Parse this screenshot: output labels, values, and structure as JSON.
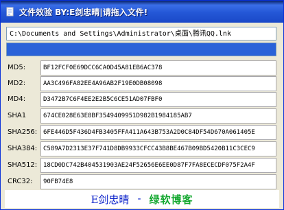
{
  "titlebar": {
    "title": "文件效验 BY:E剑忠晴|请拖入文件!",
    "icon": "app-icon"
  },
  "file_path": "C:\\Documents and Settings\\Administrator\\桌面\\腾讯QQ.lnk",
  "progress": {
    "value": 1.0,
    "color": "#2a62d8"
  },
  "hashes": [
    {
      "label": "MD5:",
      "value": "BF12FCF0E69DCC6CA0D45A81EB6AC378"
    },
    {
      "label": "MD2:",
      "value": "AA3C496FA82EE4A96AB2F19E0DB08098"
    },
    {
      "label": "MD4:",
      "value": "D3472B7C6F4EE2E2B5C6CE51AD07FBF0"
    },
    {
      "label": "SHA1",
      "value": "674CE028E63E8BF3549409951D982B1984185AB7"
    },
    {
      "label": "SHA256:",
      "value": "6FE446D5F436D4FB3405FFA411A643B753A2D0C84DF54D670A061405E"
    },
    {
      "label": "SHA384:",
      "value": "C589A7D2313E37F741D8DB9933CFCC43B8BE467B09BD5420B11C3CEC9"
    },
    {
      "label": "SHA512:",
      "value": "18CD0DC742B404531903AE24F52656E6EE0D87F7FA8ECECDF075F2A4F"
    },
    {
      "label": "CRC32:",
      "value": "90FB74E8"
    }
  ],
  "footer": {
    "author": "E剑忠晴",
    "dash": "-",
    "blog": "绿软博客"
  },
  "colors": {
    "author": "#0018c8",
    "blog": "#14a830"
  }
}
